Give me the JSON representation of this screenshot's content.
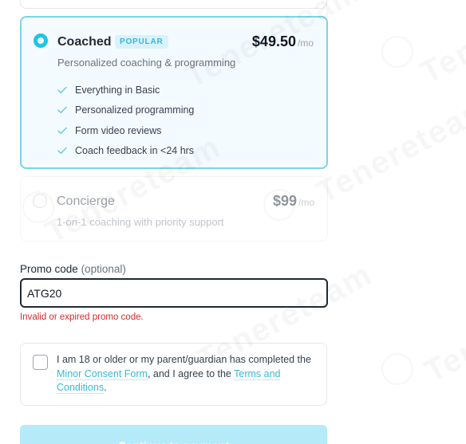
{
  "plans": [
    {
      "name": "Coached",
      "badge": "POPULAR",
      "price": "$49.50",
      "period": "/mo",
      "description": "Personalized coaching & programming",
      "features": [
        "Everything in Basic",
        "Personalized programming",
        "Form video reviews",
        "Coach feedback in <24 hrs"
      ],
      "selected": true
    },
    {
      "name": "Concierge",
      "price": "$99",
      "period": "/mo",
      "description": "1-on-1 coaching with priority support",
      "selected": false,
      "disabled": true
    }
  ],
  "promo": {
    "label": "Promo code",
    "optional": "(optional)",
    "value": "ATG20",
    "error": "Invalid or expired promo code."
  },
  "consent": {
    "text_1": "I am 18 or older or my parent/guardian has completed the ",
    "link_1": "Minor Consent Form",
    "text_2": ", and I agree to the ",
    "link_2": "Terms and Conditions",
    "text_3": "."
  },
  "continue_label": "Continue to payment",
  "watermark": "Tenereteam",
  "colors": {
    "accent": "#22c3e6",
    "selected_border": "#7dd3e8",
    "error": "#dc2626",
    "button_disabled": "#b5eaf8"
  }
}
